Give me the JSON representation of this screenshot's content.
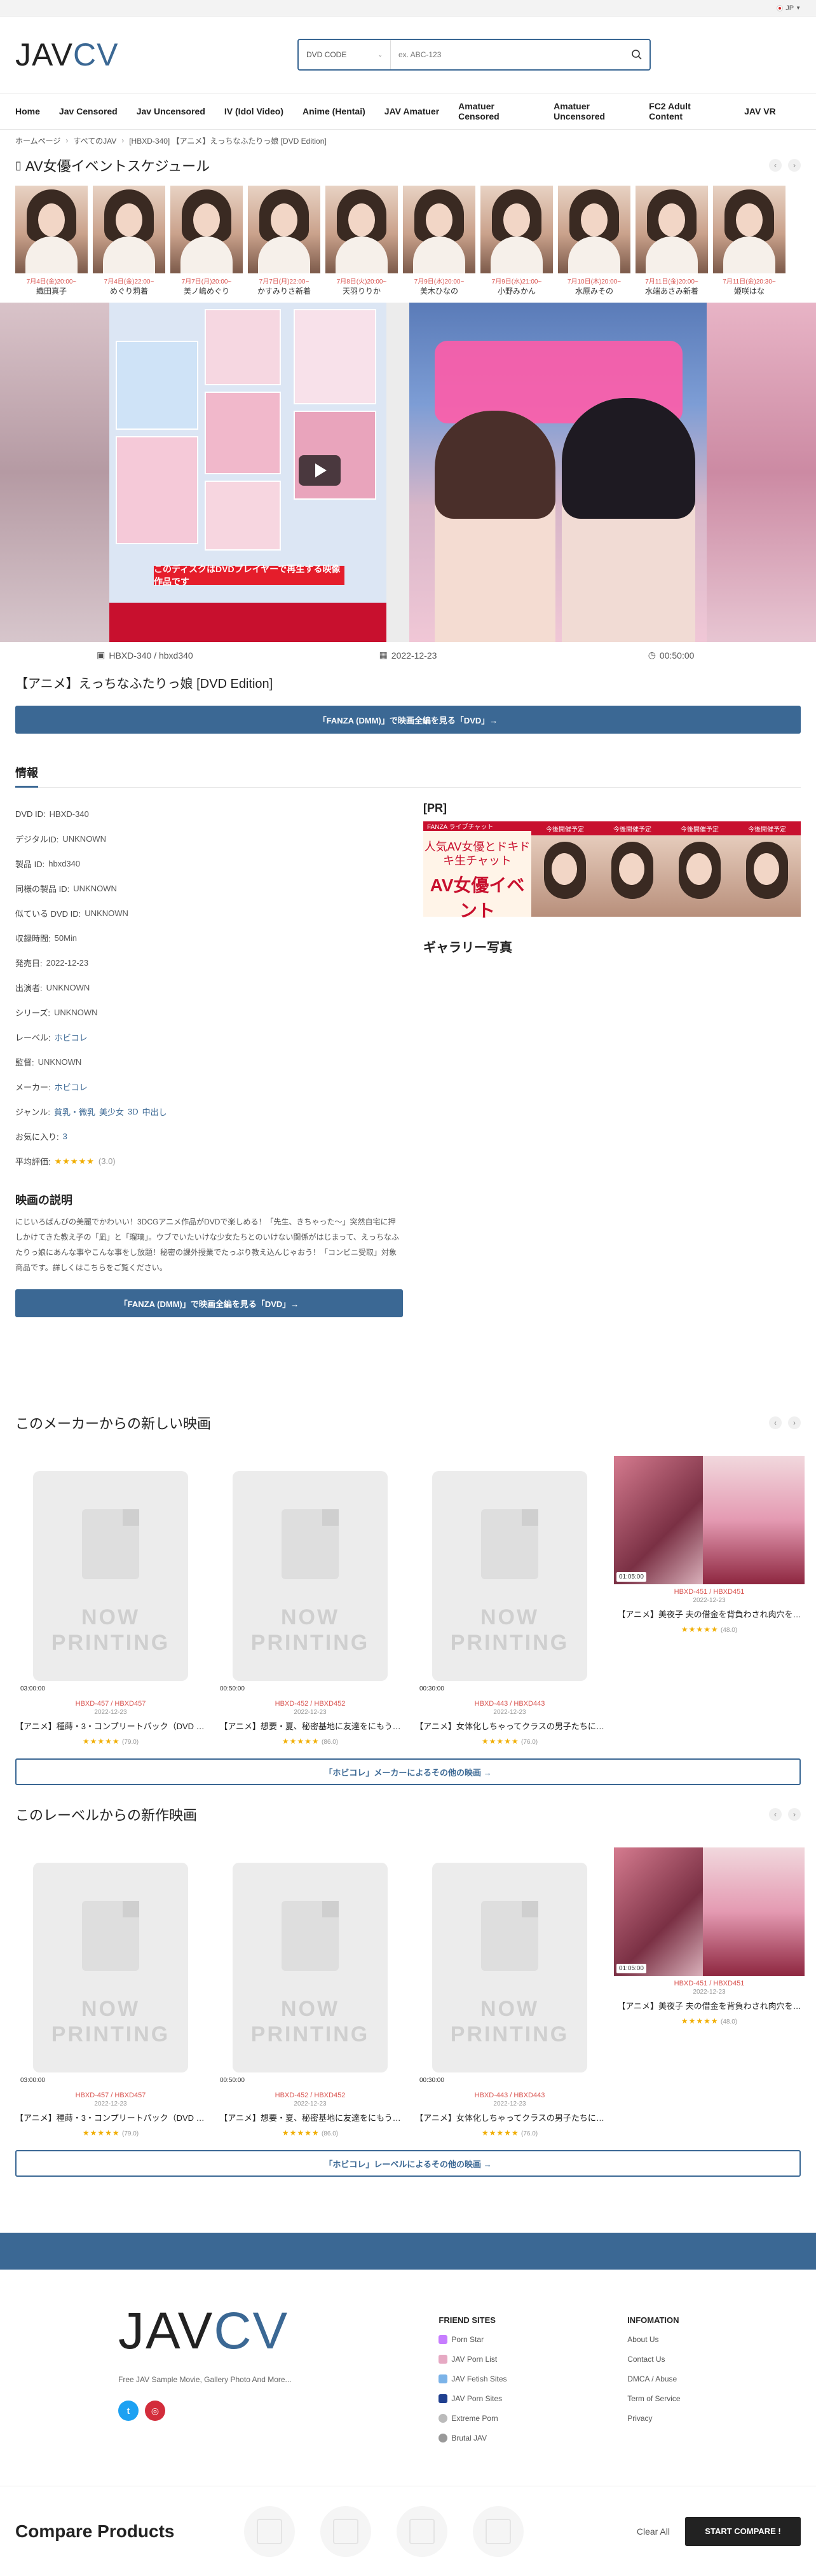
{
  "topbar": {
    "lang_label": "JP"
  },
  "header": {
    "logo_jav": "JAV",
    "logo_cv": "CV",
    "search_select": "DVD CODE",
    "search_placeholder": "ex. ABC-123"
  },
  "nav": [
    "Home",
    "Jav Censored",
    "Jav Uncensored",
    "IV (Idol Video)",
    "Anime (Hentai)",
    "JAV Amatuer",
    "Amatuer Censored",
    "Amatuer Uncensored",
    "FC2 Adult Content",
    "JAV VR"
  ],
  "breadcrumb": [
    "ホームページ",
    "すべてのJAV",
    "[HBXD-340] 【アニメ】えっちなふたりっ娘 [DVD Edition]"
  ],
  "event": {
    "title": "AV女優イベントスケジュール",
    "items": [
      {
        "date": "7月4日(金)20:00~",
        "name": "織田真子"
      },
      {
        "date": "7月4日(金)22:00~",
        "name": "めぐり莉着"
      },
      {
        "date": "7月7日(月)20:00~",
        "name": "美ノ嶋めぐり"
      },
      {
        "date": "7月7日(月)22:00~",
        "name": "かすみりさ新着"
      },
      {
        "date": "7月8日(火)20:00~",
        "name": "天羽りりか"
      },
      {
        "date": "7月9日(水)20:00~",
        "name": "美木ひなの"
      },
      {
        "date": "7月9日(水)21:00~",
        "name": "小野みかん"
      },
      {
        "date": "7月10日(木)20:00~",
        "name": "水原みその"
      },
      {
        "date": "7月11日(金)20:00~",
        "name": "水端あさみ新着"
      },
      {
        "date": "7月11日(金)20:30~",
        "name": "姫咲はな"
      }
    ]
  },
  "hero": {
    "banner_text": "このディスクはDVDプレイヤーで再生する映像作品です"
  },
  "meta": {
    "code": "HBXD-340 / hbxd340",
    "date": "2022-12-23",
    "duration": "00:50:00"
  },
  "title": "【アニメ】えっちなふたりっ娘 [DVD Edition]",
  "cta_label": "「FANZA (DMM)」で映画全編を見る「DVD」→",
  "info": {
    "heading": "情報",
    "rows": [
      {
        "label": "DVD ID:",
        "value": "HBXD-340"
      },
      {
        "label": "デジタルID:",
        "value": "UNKNOWN"
      },
      {
        "label": "製品 ID:",
        "value": "hbxd340"
      },
      {
        "label": "同様の製品 ID:",
        "value": "UNKNOWN"
      },
      {
        "label": "似ている DVD ID:",
        "value": "UNKNOWN"
      },
      {
        "label": "収録時間:",
        "value": "50Min"
      },
      {
        "label": "発売日:",
        "value": "2022-12-23"
      },
      {
        "label": "出演者:",
        "value": "UNKNOWN"
      },
      {
        "label": "シリーズ:",
        "value": "UNKNOWN"
      },
      {
        "label": "レーベル:",
        "value": "ホビコレ"
      },
      {
        "label": "監督:",
        "value": "UNKNOWN"
      },
      {
        "label": "メーカー:",
        "value": "ホビコレ"
      }
    ],
    "genre_label": "ジャンル:",
    "genres": [
      "貧乳・微乳",
      "美少女",
      "3D",
      "中出し"
    ],
    "fav_label": "お気に入り:",
    "fav_value": "3",
    "rating_label": "平均評価:",
    "rating_stars": "★★★★★",
    "rating_count": "(3.0)",
    "desc_title": "映画の説明",
    "desc_text": "にじいろばんびの美麗でかわいい！3DCGアニメ作品がDVDで楽しめる！「先生、きちゃった～」突然自宅に押しかけてきた教え子の「凪」と「瑠璃」。ウブでいたいけな少女たちとのいけない関係がはじまって、えっちなふたりっ娘にあんな事やこんな事をし放題！秘密の課外授業でたっぷり教え込んじゃおう！「コンビニ受取」対象商品です。詳しくはこちらをご覧ください。"
  },
  "pr": {
    "label": "[PR]",
    "brand": "FANZA ライブチャット",
    "headline": "人気AV女優とドキドキ生チャット",
    "big": "AV女優イベント",
    "tag": "今後開催予定"
  },
  "gallery_title": "ギャラリー写真",
  "maker_section": {
    "title": "このメーカーからの新しい映画",
    "cards": [
      {
        "np1": "NOW",
        "np2": "PRINTING",
        "duration": "03:00:00",
        "code": "HBXD-457 / HBXD457",
        "date": "2022-12-23",
        "title": "【アニメ】種蒔・3・コンプリートパック（DVD Edition）",
        "stars": "★★★★★",
        "count": "(79.0)"
      },
      {
        "np1": "NOW",
        "np2": "PRINTING",
        "duration": "00:50:00",
        "code": "HBXD-452 / HBXD452",
        "date": "2022-12-23",
        "title": "【アニメ】想要・夏、秘密基地に友達をにもう…",
        "stars": "★★★★★",
        "count": "(86.0)"
      },
      {
        "np1": "NOW",
        "np2": "PRINTING",
        "duration": "00:30:00",
        "code": "HBXD-443 / HBXD443",
        "date": "2022-12-23",
        "title": "【アニメ】女体化しちゃってクラスの男子たちに…",
        "stars": "★★★★★",
        "count": "(76.0)"
      },
      {
        "duration": "01:05:00",
        "code": "HBXD-451 / HBXD451",
        "date": "2022-12-23",
        "title": "【アニメ】美夜子 夫の借金を背負わされ肉穴を…",
        "stars": "★★★★★",
        "count": "(48.0)"
      }
    ],
    "more": "「ホビコレ」メーカーによるその他の映画 →"
  },
  "label_section": {
    "title": "このレーベルからの新作映画",
    "cards": [
      {
        "np1": "NOW",
        "np2": "PRINTING",
        "duration": "03:00:00",
        "code": "HBXD-457 / HBXD457",
        "date": "2022-12-23",
        "title": "【アニメ】種蒔・3・コンプリートパック（DVD Edition）",
        "stars": "★★★★★",
        "count": "(79.0)"
      },
      {
        "np1": "NOW",
        "np2": "PRINTING",
        "duration": "00:50:00",
        "code": "HBXD-452 / HBXD452",
        "date": "2022-12-23",
        "title": "【アニメ】想要・夏、秘密基地に友達をにもう…",
        "stars": "★★★★★",
        "count": "(86.0)"
      },
      {
        "np1": "NOW",
        "np2": "PRINTING",
        "duration": "00:30:00",
        "code": "HBXD-443 / HBXD443",
        "date": "2022-12-23",
        "title": "【アニメ】女体化しちゃってクラスの男子たちに…",
        "stars": "★★★★★",
        "count": "(76.0)"
      },
      {
        "duration": "01:05:00",
        "code": "HBXD-451 / HBXD451",
        "date": "2022-12-23",
        "title": "【アニメ】美夜子 夫の借金を背負わされ肉穴を…",
        "stars": "★★★★★",
        "count": "(48.0)"
      }
    ],
    "more": "「ホビコレ」レーベルによるその他の映画 →"
  },
  "footer": {
    "logo_jav": "JAV",
    "logo_cv": "CV",
    "tagline": "Free JAV Sample Movie, Gallery Photo And More...",
    "friend_title": "FRIEND SITES",
    "friend_links": [
      "Porn Star",
      "JAV Porn List",
      "JAV Fetish Sites",
      "JAV Porn Sites",
      "Extreme Porn",
      "Brutal JAV"
    ],
    "info_title": "INFOMATION",
    "info_links": [
      "About Us",
      "Contact Us",
      "DMCA / Abuse",
      "Term of Service",
      "Privacy"
    ]
  },
  "compare": {
    "title": "Compare Products",
    "clear": "Clear All",
    "start": "START COMPARE !"
  },
  "colors": {
    "accent": "#3b6894",
    "red": "#d9534f",
    "star": "#f0ad00"
  }
}
